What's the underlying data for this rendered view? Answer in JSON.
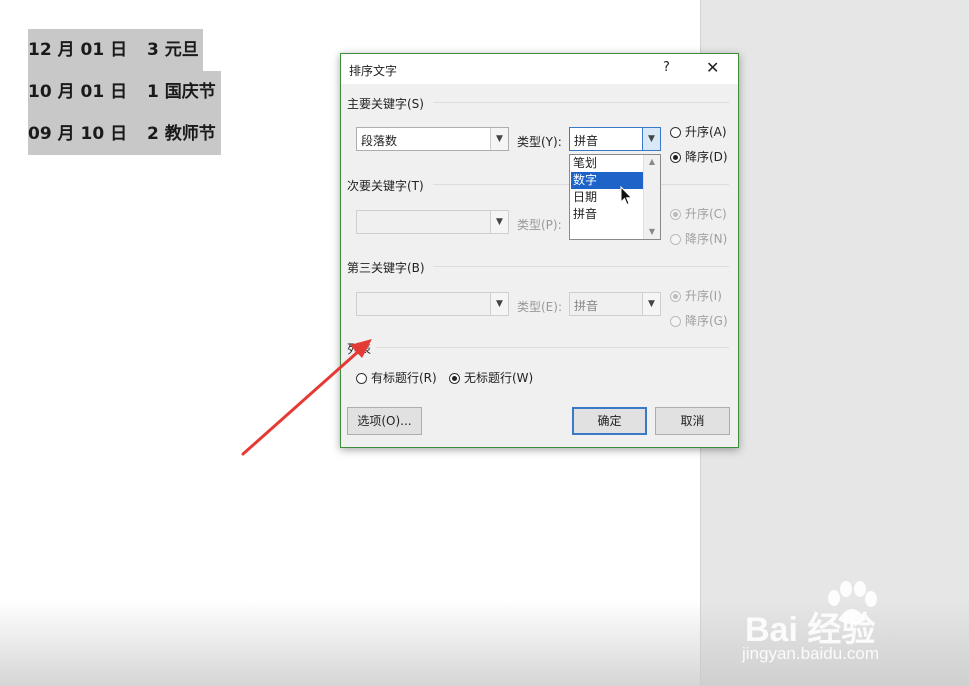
{
  "document": {
    "lines": [
      {
        "date": "12 月 01 日",
        "label": "3 元旦"
      },
      {
        "date": "10 月 01 日",
        "label": "1 国庆节"
      },
      {
        "date": "09 月 10 日",
        "label": "2 教师节"
      }
    ]
  },
  "dialog": {
    "title": "排序文字",
    "help": "?",
    "close": "✕",
    "primary_key": {
      "section_label": "主要关键字(S)",
      "field_value": "段落数",
      "type_label": "类型(Y):",
      "type_value": "拼音",
      "asc_label": "升序(A)",
      "desc_label": "降序(D)",
      "asc_selected": false,
      "desc_selected": true
    },
    "type_dropdown_options": [
      "笔划",
      "数字",
      "日期",
      "拼音"
    ],
    "type_dropdown_highlighted": "数字",
    "secondary_key": {
      "section_label": "次要关键字(T)",
      "field_value": "",
      "type_label": "类型(P):",
      "asc_label": "升序(C)",
      "desc_label": "降序(N)"
    },
    "third_key": {
      "section_label": "第三关键字(B)",
      "field_value": "",
      "type_label": "类型(E):",
      "type_value": "拼音",
      "asc_label": "升序(I)",
      "desc_label": "降序(G)"
    },
    "list": {
      "section_label": "列表",
      "has_header_label": "有标题行(R)",
      "no_header_label": "无标题行(W)",
      "no_header_selected": true
    },
    "buttons": {
      "options": "选项(O)...",
      "ok": "确定",
      "cancel": "取消"
    }
  },
  "watermark": {
    "brand": "Bai 经验",
    "url": "jingyan.baidu.com"
  },
  "colors": {
    "dialog_border": "#3c8c3c",
    "selection": "#1e64c8",
    "annotation_arrow": "#e53935",
    "doc_highlight": "#c8c8c8"
  }
}
